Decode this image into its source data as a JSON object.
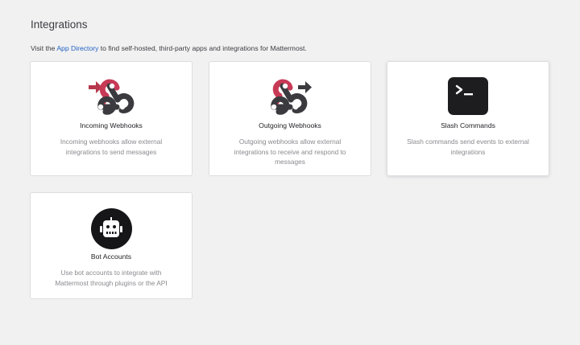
{
  "page": {
    "title": "Integrations",
    "intro_before": "Visit the ",
    "intro_link": "App Directory",
    "intro_after": " to find self-hosted, third-party apps and integrations for Mattermost."
  },
  "cards": [
    {
      "title": "Incoming Webhooks",
      "description": "Incoming webhooks allow external integrations to send messages",
      "icon": "incoming-webhook-icon"
    },
    {
      "title": "Outgoing Webhooks",
      "description": "Outgoing webhooks allow external integrations to receive and respond to messages",
      "icon": "outgoing-webhook-icon"
    },
    {
      "title": "Slash Commands",
      "description": "Slash commands send events to external integrations",
      "icon": "slash-command-icon"
    },
    {
      "title": "Bot Accounts",
      "description": "Use bot accounts to integrate with Mattermost through plugins or the API",
      "icon": "bot-icon"
    }
  ],
  "colors": {
    "background": "#f1f1f2",
    "link": "#2462c1",
    "webhook_red": "#c73a56",
    "webhook_dark": "#3b3b3f",
    "arrow_red": "#b5384d",
    "arrow_dark": "#3b3b3f"
  }
}
